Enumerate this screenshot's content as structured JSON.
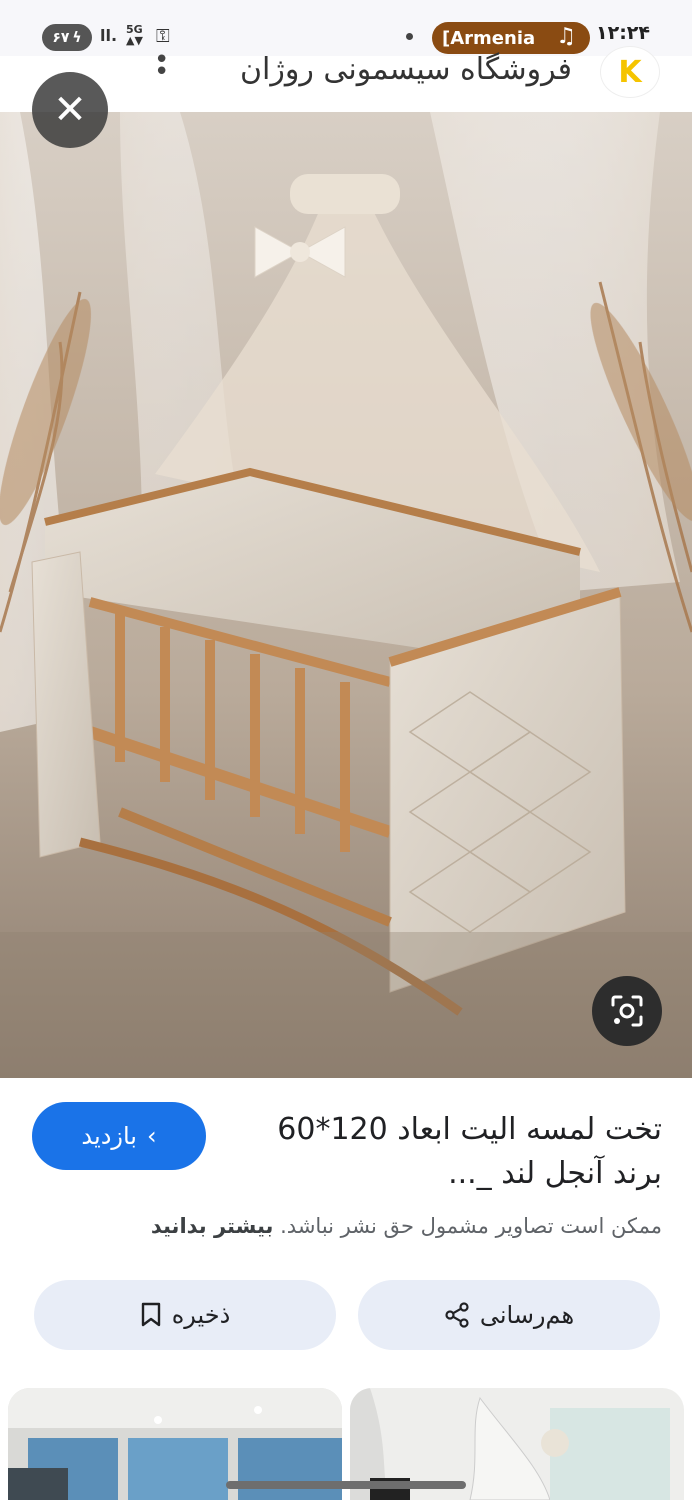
{
  "status_bar": {
    "time": "۱۲:۲۴",
    "media_app": "[Armenia",
    "battery": "۶۷"
  },
  "header": {
    "site_name": "فروشگاه سیسمونی روژان",
    "logo_letter": "K"
  },
  "result": {
    "title": "تخت لمسه الیت ابعاد 120*60 برند آنجل لند _...",
    "visit_label": "بازدید",
    "disclaimer_text": "ممکن است تصاویر مشمول حق نشر نباشد.",
    "learn_more": "بیشتر بدانید"
  },
  "actions": {
    "share_label": "هم‌رسانی",
    "save_label": "ذخیره"
  },
  "colors": {
    "accent": "#1a73e8",
    "pill_bg": "#e8edf7",
    "media_pill": "#8a4b12"
  },
  "icons": [
    "close-icon",
    "lens-icon",
    "share-icon",
    "bookmark-icon",
    "chevron-left-icon",
    "music-note-icon",
    "key-icon"
  ]
}
